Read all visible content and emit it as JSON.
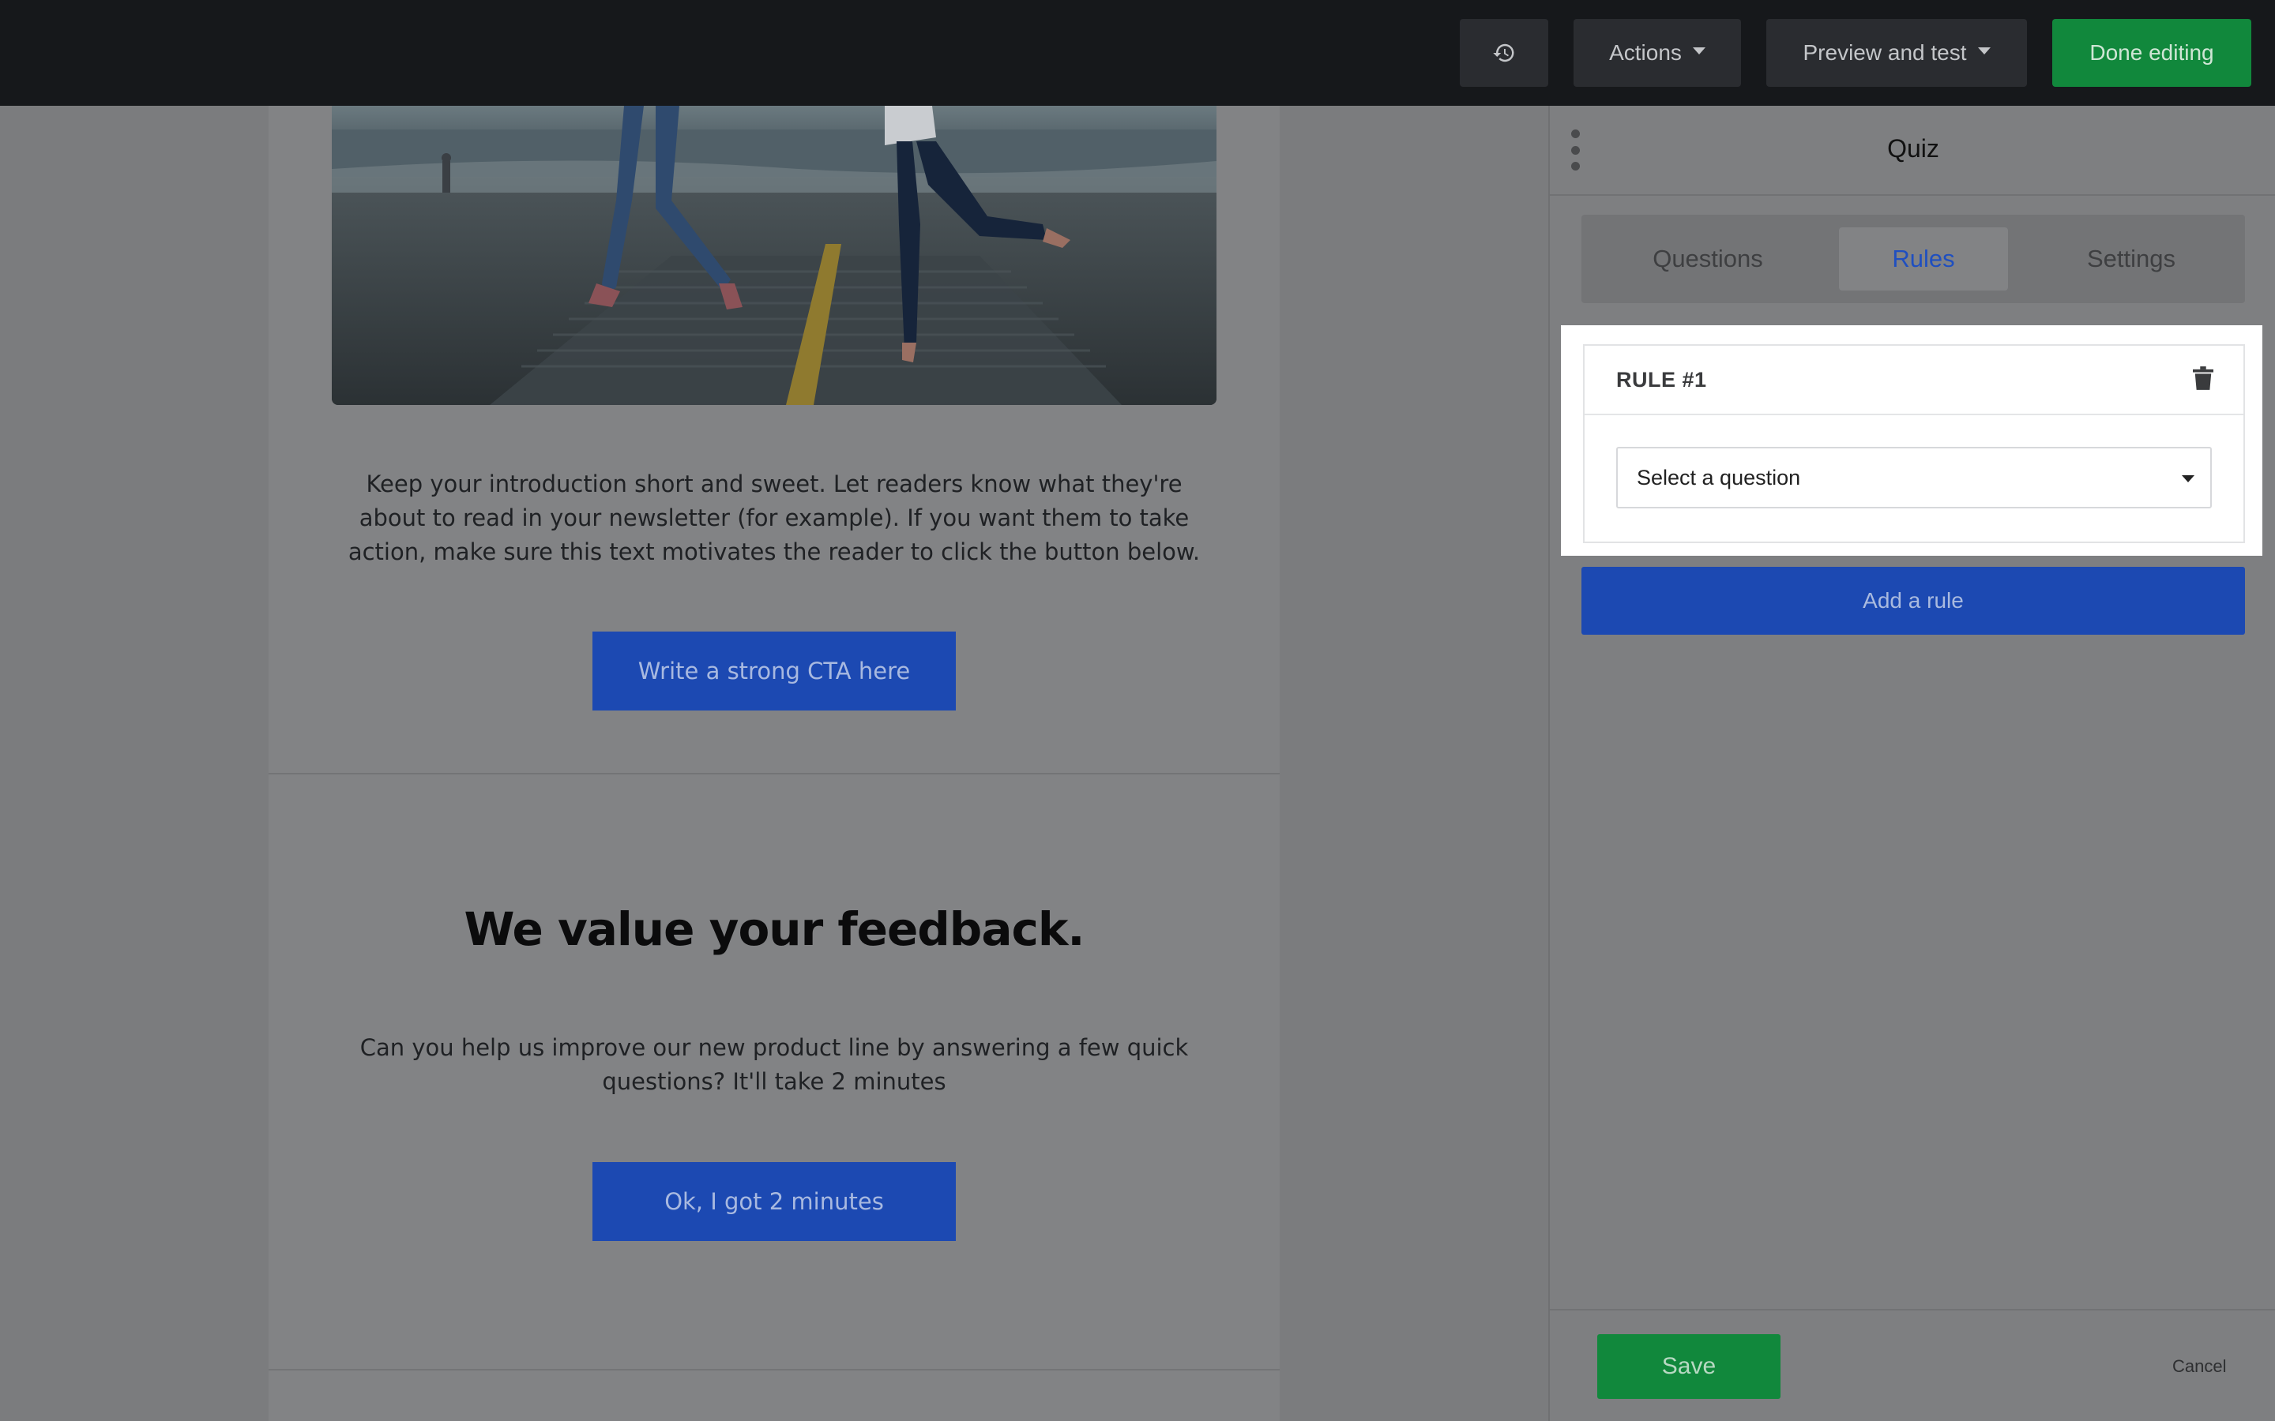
{
  "topbar": {
    "history_icon": "history-icon",
    "actions_label": "Actions",
    "preview_label": "Preview and test",
    "done_label": "Done editing"
  },
  "email": {
    "intro_text": "Keep your introduction short and sweet. Let readers know what they're about to read in your newsletter (for example). If you want them to take action, make sure this text motivates the reader to click the button below.",
    "cta_label": "Write a strong CTA here",
    "feedback_heading": "We value your feedback.",
    "feedback_text": "Can you help us improve our new product line by answering a few quick questions? It'll take 2 minutes",
    "feedback_cta_label": "Ok, I got 2 minutes"
  },
  "panel": {
    "title": "Quiz",
    "tabs": [
      {
        "label": "Questions",
        "active": false
      },
      {
        "label": "Rules",
        "active": true
      },
      {
        "label": "Settings",
        "active": false
      }
    ],
    "rule": {
      "title": "RULE #1",
      "select_value": "Select a question"
    },
    "add_rule_label": "Add a rule",
    "save_label": "Save",
    "cancel_label": "Cancel"
  },
  "colors": {
    "accent_green": "#11883c",
    "accent_blue": "#1c49b2",
    "active_tab_text": "#1f4fc0"
  }
}
